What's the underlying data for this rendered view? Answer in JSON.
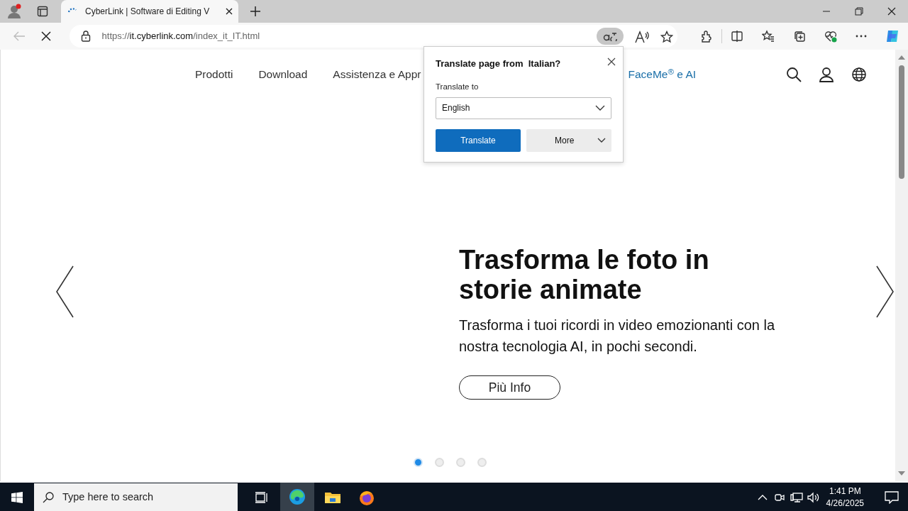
{
  "browser": {
    "tabs": [
      {
        "title": "CyberLink | Software di Editing V",
        "selected": true,
        "loading": true
      }
    ],
    "address": {
      "scheme": "https://",
      "domain": "it.cyberlink.com",
      "path": "/index_it_IT.html"
    }
  },
  "site_nav": {
    "items": [
      {
        "label": "Prodotti",
        "highlight": false
      },
      {
        "label": "Download",
        "highlight": false
      },
      {
        "label": "Assistenza e Appr",
        "highlight": false
      },
      {
        "label": "FaceMe$^{®}$ e AI",
        "highlight": true
      }
    ]
  },
  "translate_popup": {
    "title": "Translate page from  Italian?",
    "field_label": "Translate to",
    "language": "English",
    "buttons": [
      "Translate",
      "More"
    ]
  },
  "hero": {
    "heading": "Trasforma le foto in storie animate",
    "text": "Trasforma i tuoi ricordi in video emozionanti con la nostra tecnologia AI, in pochi secondi.",
    "button": "Più Info"
  },
  "carousel_dots": [
    {
      "selected": true
    },
    {
      "selected": false
    },
    {
      "selected": false
    },
    {
      "selected": false
    }
  ],
  "taskbar": {
    "search_placeholder": "Type here to search",
    "time": "1:41 PM",
    "date": "4/26/2025"
  }
}
